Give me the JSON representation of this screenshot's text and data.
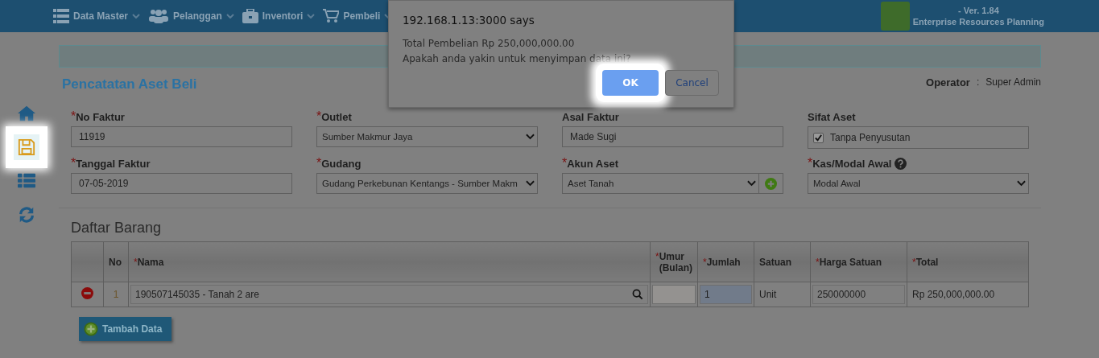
{
  "header": {
    "menu": [
      {
        "label": "Data Master",
        "kind": "list"
      },
      {
        "label": "Pelanggan",
        "kind": "users"
      },
      {
        "label": "Inventori",
        "kind": "briefcase"
      },
      {
        "label": "Pembeli",
        "kind": "cart"
      }
    ],
    "version": "- Ver. 1.84",
    "app_name": "Enterprise Resources Planning"
  },
  "sidebar": {
    "items": [
      {
        "kind": "home",
        "selected": false
      },
      {
        "kind": "save",
        "selected": true
      },
      {
        "kind": "list",
        "selected": false
      },
      {
        "kind": "refresh",
        "selected": false
      }
    ]
  },
  "page": {
    "title": "Pencatatan Aset Beli",
    "operator_label": "Operator",
    "separator": ":",
    "operator": "Super Admin"
  },
  "form": {
    "fields": [
      {
        "label": "No Faktur",
        "required_mark": "*",
        "kind": "text",
        "value": "11919"
      },
      {
        "label": "Outlet",
        "required_mark": "*",
        "kind": "select",
        "value": "Sumber Makmur Jaya"
      },
      {
        "label": "Asal Faktur",
        "kind": "text",
        "value": "Made Sugi"
      },
      {
        "label": "Sifat Aset",
        "kind": "checkbox",
        "value": "Tanpa Penyusutan",
        "checked": true
      },
      {
        "label": "Tanggal Faktur",
        "required_mark": "*",
        "kind": "text",
        "value": "07-05-2019"
      },
      {
        "label": "Gudang",
        "required_mark": "*",
        "kind": "select",
        "value": "Gudang Perkebunan Kentangs - Sumber Makm"
      },
      {
        "label": "Akun Aset",
        "required_mark": "*",
        "kind": "select_add",
        "value": "Aset Tanah"
      },
      {
        "label": "Kas/Modal Awal",
        "required_mark": "*",
        "kind": "select",
        "value": "Modal Awal",
        "help": true
      }
    ]
  },
  "items": {
    "title": "Daftar Barang",
    "columns": [
      {
        "label": "No"
      },
      {
        "label": "Nama",
        "required_mark": "*"
      },
      {
        "label": "Umur (Bulan)",
        "required_mark": "*"
      },
      {
        "label": "Jumlah",
        "required_mark": "*"
      },
      {
        "label": "Satuan"
      },
      {
        "label": "Harga Satuan",
        "required_mark": "*"
      },
      {
        "label": "Total",
        "required_mark": "*"
      }
    ],
    "rows": [
      {
        "no": "1",
        "nama": "190507145035 - Tanah 2 are",
        "jumlah": "1",
        "satuan": "Unit",
        "harga": "250000000",
        "total": "Rp 250,000,000.00"
      }
    ],
    "add_button": "Tambah Data"
  },
  "dialog": {
    "title": "192.168.1.13:3000 says",
    "lines": [
      "Total Pembelian Rp 250,000,000.00",
      "Apakah anda yakin untuk menyimpan data ini?"
    ],
    "buttons": [
      {
        "label": "OK",
        "selected": true
      },
      {
        "label": "Cancel",
        "selected": false
      }
    ]
  }
}
